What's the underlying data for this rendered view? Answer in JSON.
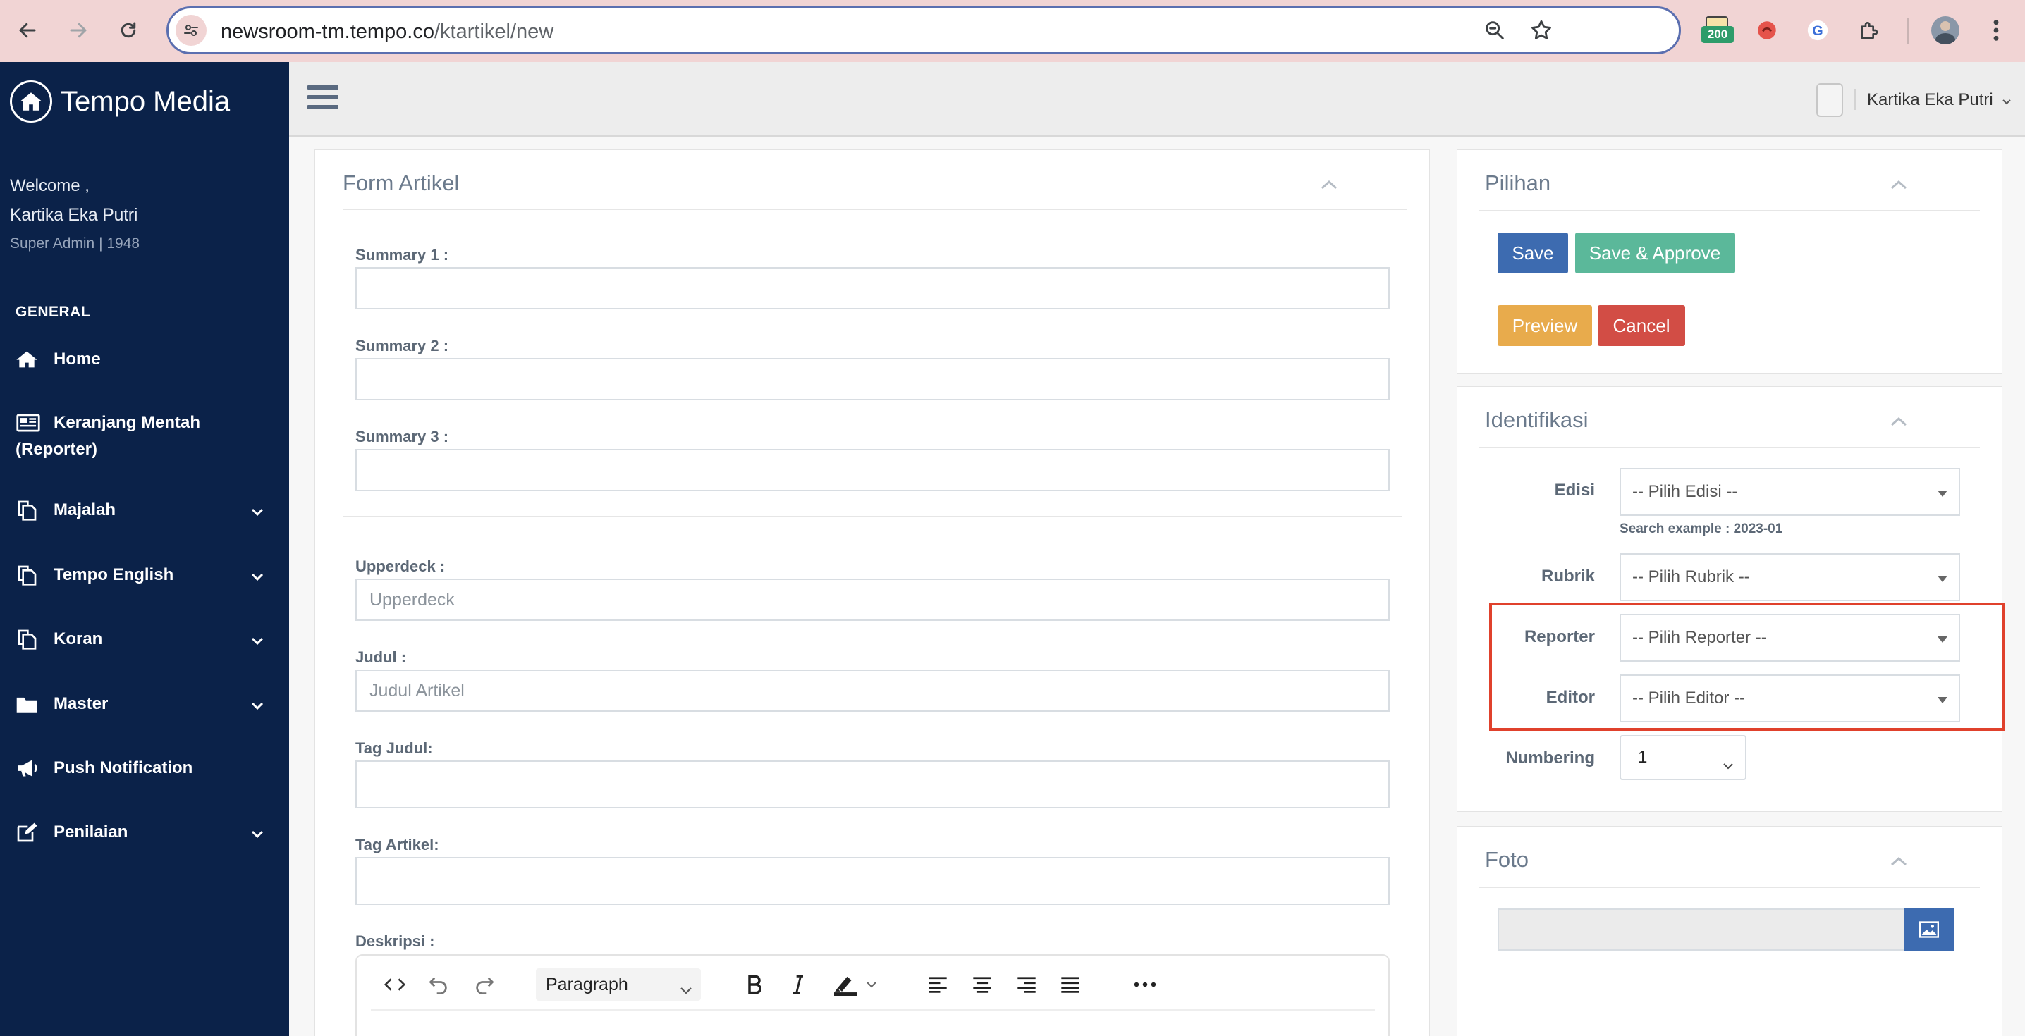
{
  "browser": {
    "url_host": "newsroom-tm.tempo.co",
    "url_path": "/ktartikel/new",
    "extension_badge": "200"
  },
  "sidebar": {
    "brand": "Tempo Media",
    "welcome": "Welcome ,",
    "username": "Kartika Eka Putri",
    "role": "Super Admin | 1948",
    "section": "GENERAL",
    "items": [
      {
        "label": "Home",
        "icon": "home-icon"
      },
      {
        "label": "Keranjang Mentah",
        "label2": "(Reporter)",
        "icon": "newspaper-icon"
      },
      {
        "label": "Majalah",
        "icon": "copy-icon"
      },
      {
        "label": "Tempo English",
        "icon": "copy-icon"
      },
      {
        "label": "Koran",
        "icon": "copy-icon"
      },
      {
        "label": "Master",
        "icon": "folder-icon"
      },
      {
        "label": "Push Notification",
        "icon": "megaphone-icon"
      },
      {
        "label": "Penilaian",
        "icon": "edit-icon"
      }
    ]
  },
  "header": {
    "user_name": "Kartika Eka Putri"
  },
  "form": {
    "title": "Form Artikel",
    "summary1_label": "Summary 1 :",
    "summary2_label": "Summary 2 :",
    "summary3_label": "Summary 3 :",
    "upperdeck_label": "Upperdeck :",
    "upperdeck_placeholder": "Upperdeck",
    "judul_label": "Judul :",
    "judul_placeholder": "Judul Artikel",
    "tag_judul_label": "Tag Judul:",
    "tag_artikel_label": "Tag Artikel:",
    "deskripsi_label": "Deskripsi :",
    "editor_format": "Paragraph"
  },
  "pilihan": {
    "title": "Pilihan",
    "save": "Save",
    "save_approve": "Save & Approve",
    "preview": "Preview",
    "cancel": "Cancel"
  },
  "identifikasi": {
    "title": "Identifikasi",
    "edisi_label": "Edisi",
    "edisi_value": "-- Pilih Edisi --",
    "edisi_hint": "Search example : 2023-01",
    "rubrik_label": "Rubrik",
    "rubrik_value": "-- Pilih Rubrik --",
    "reporter_label": "Reporter",
    "reporter_value": "-- Pilih Reporter --",
    "editor_label": "Editor",
    "editor_value": "-- Pilih Editor --",
    "numbering_label": "Numbering",
    "numbering_value": "1"
  },
  "foto": {
    "title": "Foto"
  },
  "colors": {
    "sidebar_bg": "#0b2249",
    "save": "#3d6bb0",
    "save_approve": "#5bb89a",
    "preview": "#e8ab4c",
    "cancel": "#d24d45",
    "highlight": "#e0412c"
  }
}
